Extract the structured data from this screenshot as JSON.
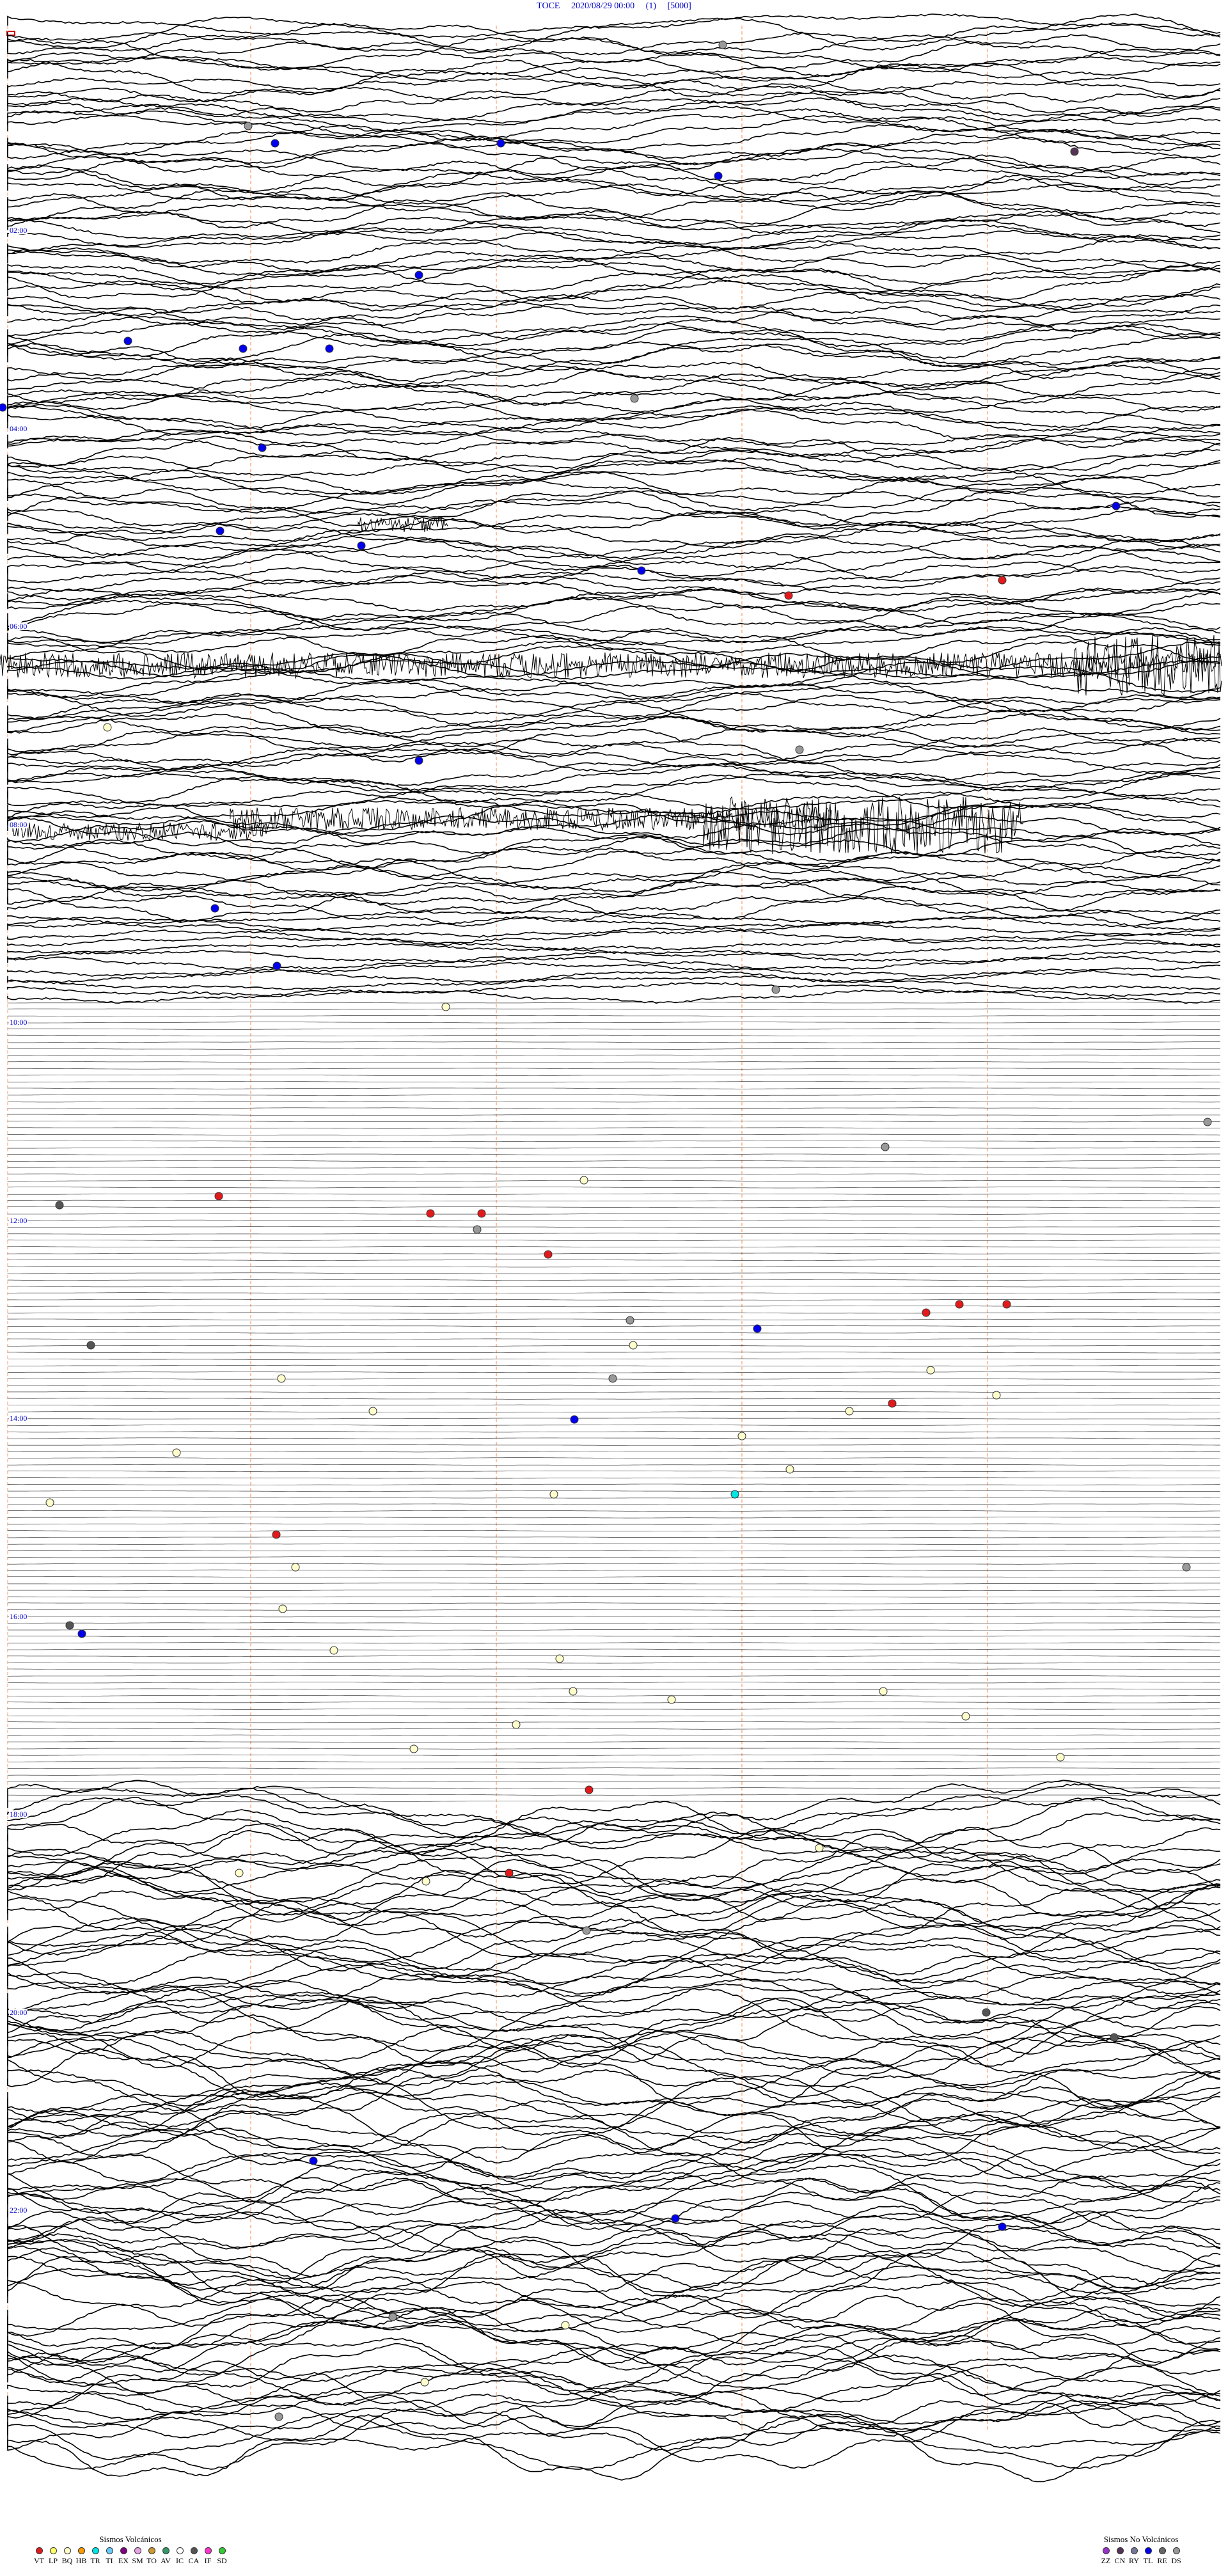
{
  "header": {
    "station": "TOCE",
    "date": "2020/08/29 00:00",
    "channel": "(1)",
    "scale": "[5000]"
  },
  "hour_labels": [
    "02:00",
    "04:00",
    "06:00",
    "08:00",
    "10:00",
    "12:00",
    "14:00",
    "16:00",
    "18:00",
    "20:00",
    "22:00"
  ],
  "legend_volcanic": {
    "title": "Sismos Volcánicos",
    "items": [
      {
        "code": "VT",
        "color": "#e31a1c"
      },
      {
        "code": "LP",
        "color": "#ffff66"
      },
      {
        "code": "BQ",
        "color": "#ffffcc"
      },
      {
        "code": "HB",
        "color": "#ff9900"
      },
      {
        "code": "TR",
        "color": "#00e5e5"
      },
      {
        "code": "TI",
        "color": "#66ccff"
      },
      {
        "code": "EX",
        "color": "#800080"
      },
      {
        "code": "SM",
        "color": "#e6a3e6"
      },
      {
        "code": "TO",
        "color": "#cc9933"
      },
      {
        "code": "AV",
        "color": "#339966"
      },
      {
        "code": "IC",
        "color": "#ffffff"
      },
      {
        "code": "CA",
        "color": "#555555"
      },
      {
        "code": "IF",
        "color": "#ff33cc"
      },
      {
        "code": "SD",
        "color": "#33cc33"
      }
    ]
  },
  "legend_nonvolcanic": {
    "title": "Sismos No Volcánicos",
    "items": [
      {
        "code": "ZZ",
        "color": "#9933cc"
      },
      {
        "code": "CN",
        "color": "#553355"
      },
      {
        "code": "RY",
        "color": "#777799"
      },
      {
        "code": "TL",
        "color": "#0000ee"
      },
      {
        "code": "RE",
        "color": "#666666"
      },
      {
        "code": "DS",
        "color": "#999999"
      }
    ]
  }
}
